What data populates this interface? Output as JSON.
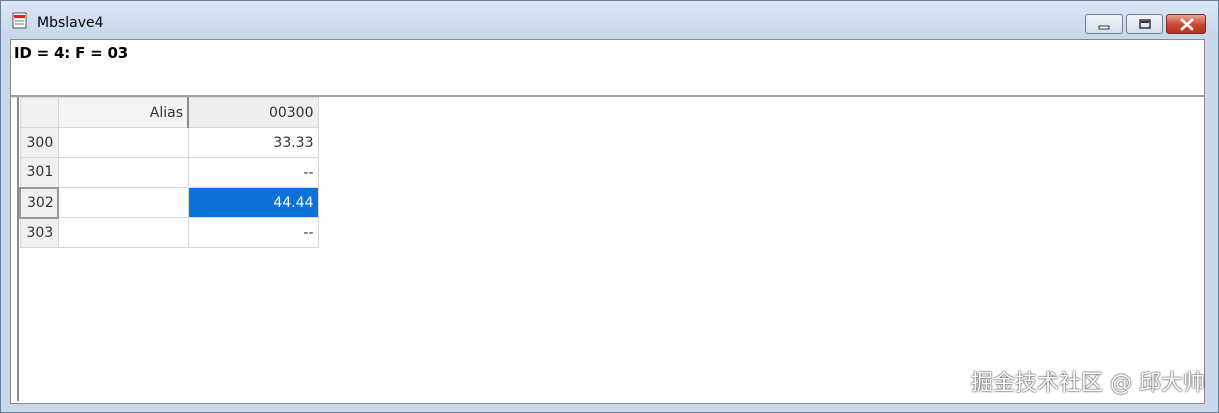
{
  "window": {
    "title": "Mbslave4",
    "icon": "document-icon"
  },
  "status_line": "ID = 4: F = 03",
  "grid": {
    "columns": [
      "Alias",
      "00300"
    ],
    "rows": [
      {
        "address": "300",
        "alias": "",
        "value": "33.33",
        "selected": false
      },
      {
        "address": "301",
        "alias": "",
        "value": "--",
        "selected": false
      },
      {
        "address": "302",
        "alias": "",
        "value": "44.44",
        "selected": true
      },
      {
        "address": "303",
        "alias": "",
        "value": "--",
        "selected": false
      }
    ]
  },
  "colors": {
    "selection": "#0a72d8",
    "close_button": "#c94631"
  },
  "watermark": "掘金技术社区 @ 邱大帅"
}
